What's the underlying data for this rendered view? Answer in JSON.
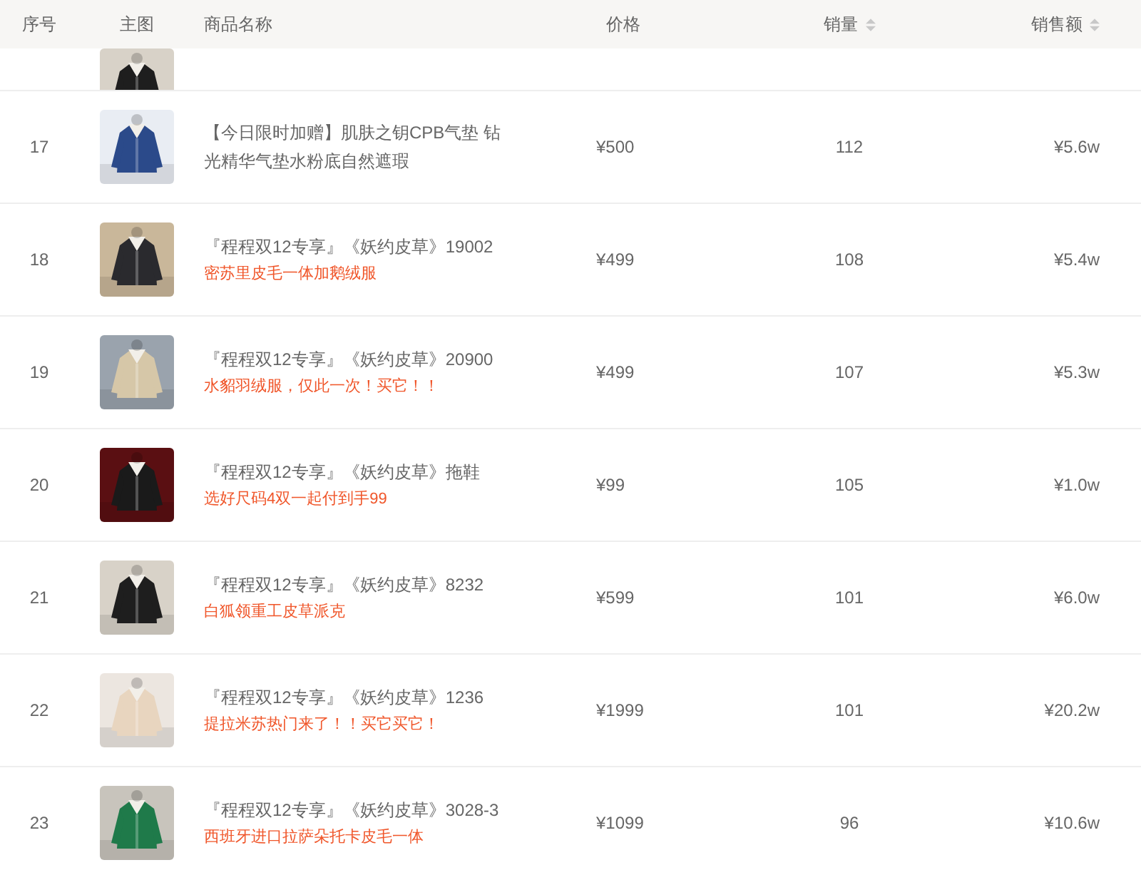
{
  "table": {
    "columns": [
      {
        "label": "序号",
        "sortable": false
      },
      {
        "label": "主图",
        "sortable": false
      },
      {
        "label": "商品名称",
        "sortable": false
      },
      {
        "label": "价格",
        "sortable": false
      },
      {
        "label": "销量",
        "sortable": true
      },
      {
        "label": "销售额",
        "sortable": true
      }
    ],
    "rows": [
      {
        "index": "17",
        "title": "【今日限时加赠】肌肤之钥CPB气垫 钻光精华气垫水粉底自然遮瑕",
        "price": "¥500",
        "sales": "112",
        "revenue": "¥5.6w"
      },
      {
        "index": "18",
        "title": "『程程双12专享』《妖约皮草》19002",
        "subtitle": "密苏里皮毛一体加鹅绒服",
        "price": "¥499",
        "sales": "108",
        "revenue": "¥5.4w"
      },
      {
        "index": "19",
        "title": "『程程双12专享』《妖约皮草》20900",
        "subtitle": "水貂羽绒服，仅此一次！买它！！",
        "price": "¥499",
        "sales": "107",
        "revenue": "¥5.3w"
      },
      {
        "index": "20",
        "title": "『程程双12专享』《妖约皮草》拖鞋",
        "subtitle": "选好尺码4双一起付到手99",
        "price": "¥99",
        "sales": "105",
        "revenue": "¥1.0w"
      },
      {
        "index": "21",
        "title": "『程程双12专享』《妖约皮草》8232",
        "subtitle": "白狐领重工皮草派克",
        "price": "¥599",
        "sales": "101",
        "revenue": "¥6.0w"
      },
      {
        "index": "22",
        "title": "『程程双12专享』《妖约皮草》1236",
        "subtitle": "提拉米苏热门来了！！买它买它！",
        "price": "¥1999",
        "sales": "101",
        "revenue": "¥20.2w"
      },
      {
        "index": "23",
        "title": "『程程双12专享』《妖约皮草》3028-3",
        "subtitle": "西班牙进口拉萨朵托卡皮毛一体",
        "price": "¥1099",
        "sales": "96",
        "revenue": "¥10.6w"
      }
    ]
  }
}
